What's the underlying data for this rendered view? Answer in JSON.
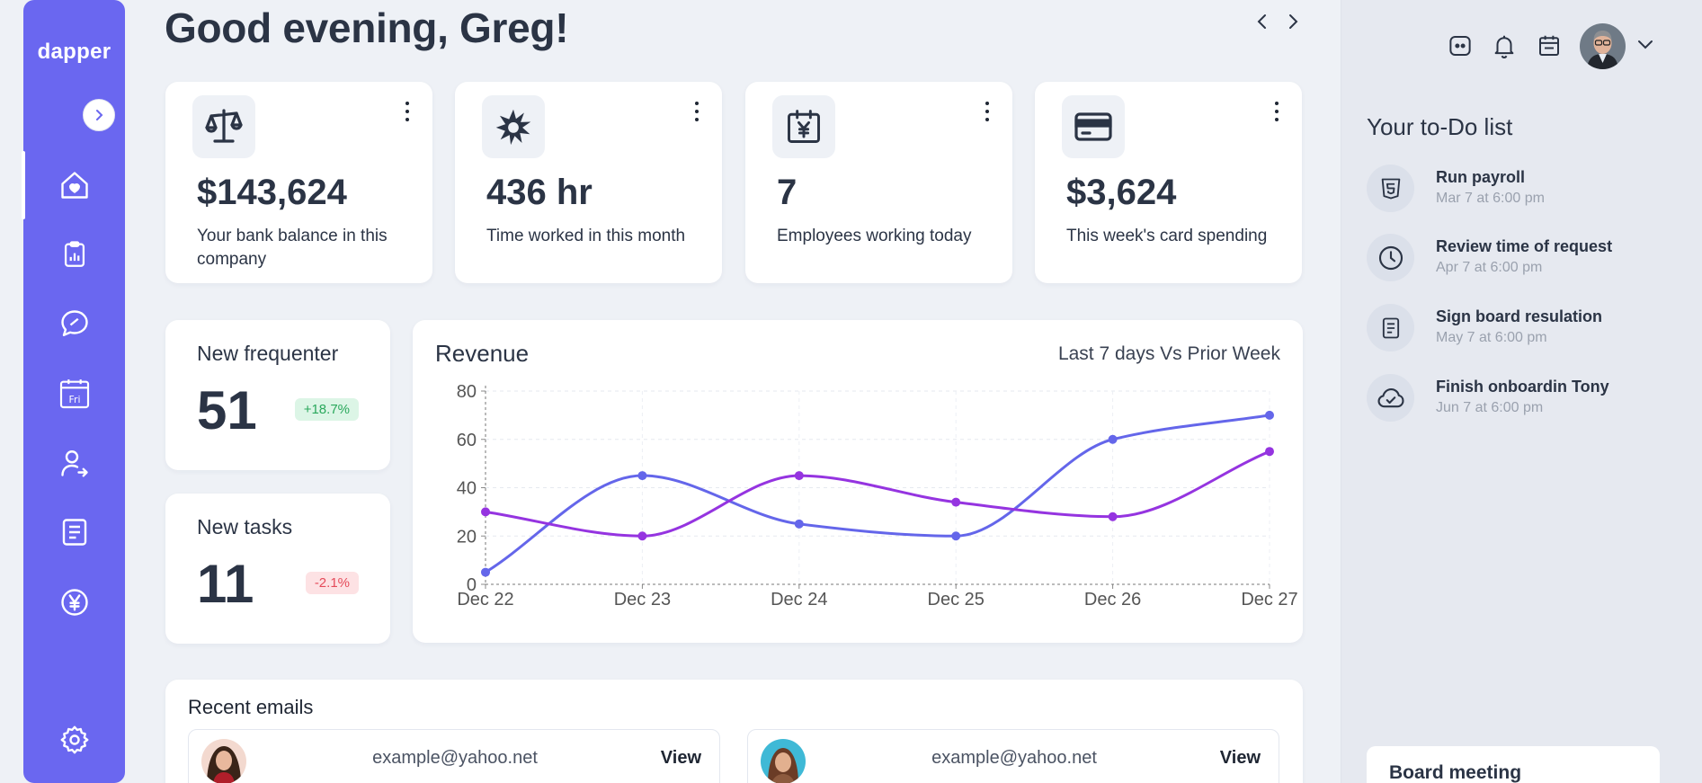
{
  "app": {
    "logo": "dapper"
  },
  "header": {
    "greeting": "Good evening, Greg!"
  },
  "sidebar": {
    "items": [
      {
        "name": "home",
        "icon": "home-heart-icon",
        "active": true
      },
      {
        "name": "tasks",
        "icon": "clipboard-icon"
      },
      {
        "name": "messages",
        "icon": "chat-icon"
      },
      {
        "name": "calendar",
        "icon": "calendar-icon",
        "label": "Fri"
      },
      {
        "name": "people",
        "icon": "user-transfer-icon"
      },
      {
        "name": "documents",
        "icon": "document-icon"
      },
      {
        "name": "finance",
        "icon": "yen-icon"
      }
    ],
    "settings_icon": "gear-icon"
  },
  "stats": [
    {
      "value": "$143,624",
      "label": "Your bank balance in this company",
      "icon": "scale-icon"
    },
    {
      "value": "436 hr",
      "label": "Time worked in this month",
      "icon": "burst-icon"
    },
    {
      "value": "7",
      "label": "Employees working today",
      "icon": "calendar-yen-icon"
    },
    {
      "value": "$3,624",
      "label": "This week's card spending",
      "icon": "credit-card-icon"
    }
  ],
  "mini_cards": [
    {
      "title": "New frequenter",
      "value": "51",
      "badge": "+18.7%",
      "trend": "up"
    },
    {
      "title": "New tasks",
      "value": "11",
      "badge": "-2.1%",
      "trend": "down"
    }
  ],
  "revenue": {
    "title": "Revenue",
    "subtitle": "Last 7 days Vs Prior Week"
  },
  "chart_data": {
    "type": "line",
    "title": "Revenue",
    "categories": [
      "Dec 22",
      "Dec 23",
      "Dec 24",
      "Dec 25",
      "Dec 26",
      "Dec 27"
    ],
    "ylim": [
      0,
      80
    ],
    "yticks": [
      0,
      20,
      40,
      60,
      80
    ],
    "grid": true,
    "series": [
      {
        "values": [
          5,
          45,
          25,
          20,
          60,
          70
        ],
        "color": "#6466ea"
      },
      {
        "values": [
          30,
          20,
          45,
          34,
          28,
          55
        ],
        "color": "#9534e0"
      }
    ]
  },
  "emails": {
    "title": "Recent emails",
    "items": [
      {
        "address": "example@yahoo.net",
        "action": "View"
      },
      {
        "address": "example@yahoo.net",
        "action": "View"
      }
    ]
  },
  "right_panel": {
    "todo_title": "Your to-Do list",
    "todos": [
      {
        "name": "Run payroll",
        "time": "Mar 7 at 6:00 pm",
        "icon": "html5-icon"
      },
      {
        "name": "Review time of request",
        "time": "Apr 7 at 6:00 pm",
        "icon": "clock-icon"
      },
      {
        "name": "Sign board resulation",
        "time": "May 7 at 6:00 pm",
        "icon": "document-icon"
      },
      {
        "name": "Finish onboardin Tony",
        "time": "Jun 7 at 6:00 pm",
        "icon": "cloud-check-icon"
      }
    ],
    "board_title": "Board meeting"
  },
  "colors": {
    "accent": "#6a67f0",
    "series_a": "#6466ea",
    "series_b": "#9534e0",
    "bg": "#eef1f6"
  }
}
